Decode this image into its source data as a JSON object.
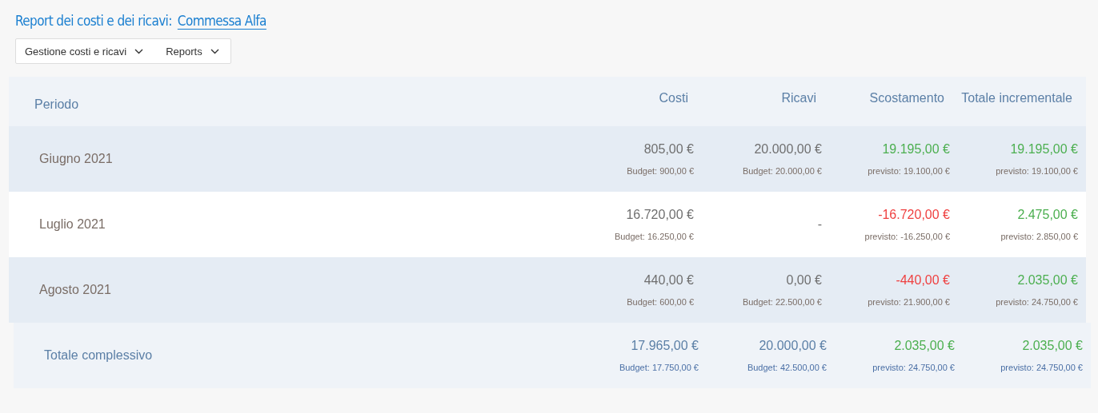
{
  "title": {
    "label": "Report dei costi e dei ricavi:",
    "link": "Commessa Alfa"
  },
  "menu": [
    {
      "label": "Gestione costi e ricavi"
    },
    {
      "label": "Reports"
    }
  ],
  "table": {
    "columns": [
      "Periodo",
      "Costi",
      "Ricavi",
      "Scostamento",
      "Totale incrementale"
    ],
    "rows": [
      {
        "kind": "month",
        "shaded": true,
        "cells": [
          {
            "value": "Giugno 2021"
          },
          {
            "value": "805,00 €",
            "note": "Budget: 900,00 €"
          },
          {
            "value": "20.000,00 €",
            "note": "Budget: 20.000,00 €"
          },
          {
            "value": "19.195,00 €",
            "note": "previsto: 19.100,00 €",
            "color": "#4caf50"
          },
          {
            "value": "19.195,00 €",
            "note": "previsto: 19.100,00 €",
            "color": "#4caf50"
          }
        ]
      },
      {
        "kind": "month",
        "shaded": false,
        "cells": [
          {
            "value": "Luglio 2021"
          },
          {
            "value": "16.720,00 €",
            "note": "Budget: 16.250,00 €"
          },
          {
            "value": "-"
          },
          {
            "value": "-16.720,00 €",
            "note": "previsto: -16.250,00 €",
            "color": "#ef4040"
          },
          {
            "value": "2.475,00 €",
            "note": "previsto: 2.850,00 €",
            "color": "#4caf50"
          }
        ]
      },
      {
        "kind": "month",
        "shaded": true,
        "cells": [
          {
            "value": "Agosto 2021"
          },
          {
            "value": "440,00 €",
            "note": "Budget: 600,00 €"
          },
          {
            "value": "0,00 €",
            "note": "Budget: 22.500,00 €"
          },
          {
            "value": "-440,00 €",
            "note": "previsto: 21.900,00 €",
            "color": "#ef4040"
          },
          {
            "value": "2.035,00 €",
            "note": "previsto: 24.750,00 €",
            "color": "#4caf50"
          }
        ]
      },
      {
        "kind": "total",
        "cells": [
          {
            "value": "Totale complessivo"
          },
          {
            "value": "17.965,00 €",
            "note": "Budget: 17.750,00 €"
          },
          {
            "value": "20.000,00 €",
            "note": "Budget: 42.500,00 €"
          },
          {
            "value": "2.035,00 €",
            "note": "previsto: 24.750,00 €",
            "color": "#4caf50"
          },
          {
            "value": "2.035,00 €",
            "note": "previsto: 24.750,00 €",
            "color": "#4caf50"
          }
        ]
      }
    ]
  }
}
